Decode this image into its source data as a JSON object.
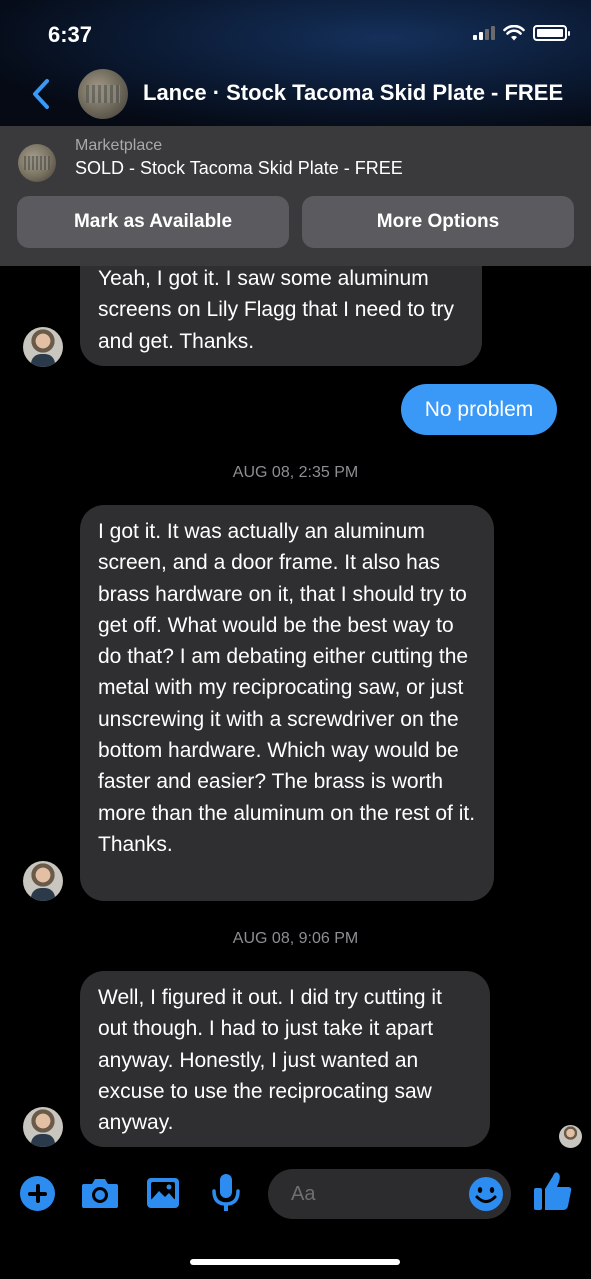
{
  "status": {
    "time": "6:37"
  },
  "header": {
    "title": "Lance · Stock Tacoma Skid Plate - FREE"
  },
  "banner": {
    "label": "Marketplace",
    "title": "SOLD - Stock Tacoma Skid Plate - FREE",
    "mark_available": "Mark as Available",
    "more_options": "More Options"
  },
  "messages": {
    "m1": "Yeah, I got it. I saw some aluminum screens on Lily Flagg that I need to try and get. Thanks.",
    "m2": "No problem",
    "stamp1": "AUG 08, 2:35 PM",
    "m3": "I got it. It was actually an aluminum screen, and a door frame. It also has brass hardware on it, that I should try to get off. What would be the best way to do that? I am debating either cutting the metal with my reciprocating saw, or just unscrewing it with a screwdriver on the bottom hardware. Which way would be faster and easier? The brass is worth more than the aluminum on the rest of it. Thanks.",
    "stamp2": "AUG 08, 9:06 PM",
    "m4": "Well, I figured it out. I did try cutting it out though. I had to just take it apart anyway. Honestly, I just wanted an excuse to use the reciprocating saw anyway."
  },
  "composer": {
    "placeholder": "Aa"
  },
  "colors": {
    "accent": "#2d8cf0",
    "my_bubble": "#3a98f7",
    "their_bubble": "#2f2f31",
    "banner_bg": "#3a3a3c"
  },
  "icons": [
    "back-chevron-icon",
    "add-icon",
    "camera-icon",
    "image-icon",
    "microphone-icon",
    "emoji-icon",
    "thumbs-up-icon"
  ]
}
